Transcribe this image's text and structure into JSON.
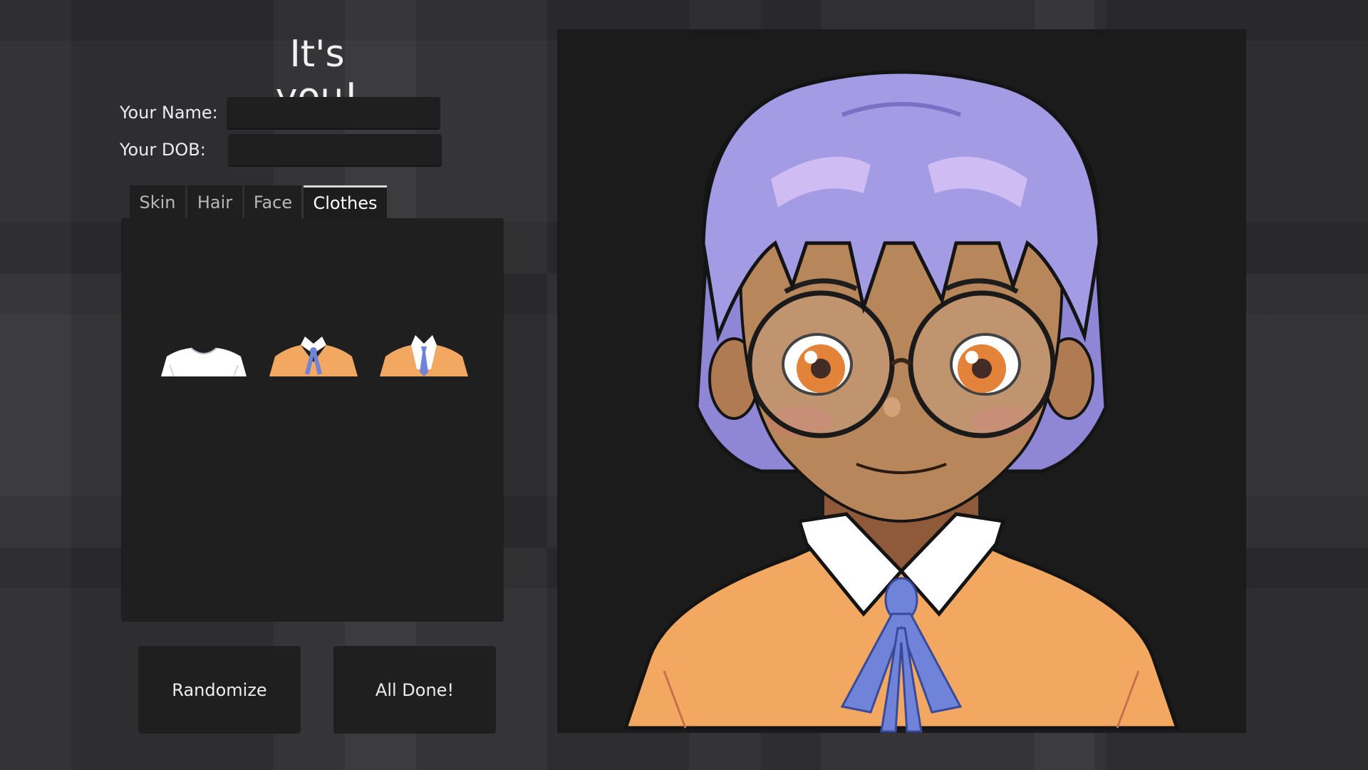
{
  "title": "It's you!",
  "form": {
    "name_label": "Your Name:",
    "name_value": "",
    "dob_label": "Your DOB:",
    "dob_value": ""
  },
  "tabs": [
    {
      "label": "Skin",
      "active": false
    },
    {
      "label": "Hair",
      "active": false
    },
    {
      "label": "Face",
      "active": false
    },
    {
      "label": "Clothes",
      "active": true
    }
  ],
  "clothes_options": [
    {
      "icon": "white-tshirt-icon"
    },
    {
      "icon": "orange-sweater-bow-icon"
    },
    {
      "icon": "orange-sweater-tie-icon"
    }
  ],
  "buttons": {
    "randomize": "Randomize",
    "done": "All Done!"
  },
  "colors": {
    "background": "#2b2b2e",
    "panel": "#1f1f1f",
    "hair": "#9a92dd",
    "skin": "#b8865b",
    "sweater": "#f3a862",
    "ribbon": "#6f83d8"
  }
}
